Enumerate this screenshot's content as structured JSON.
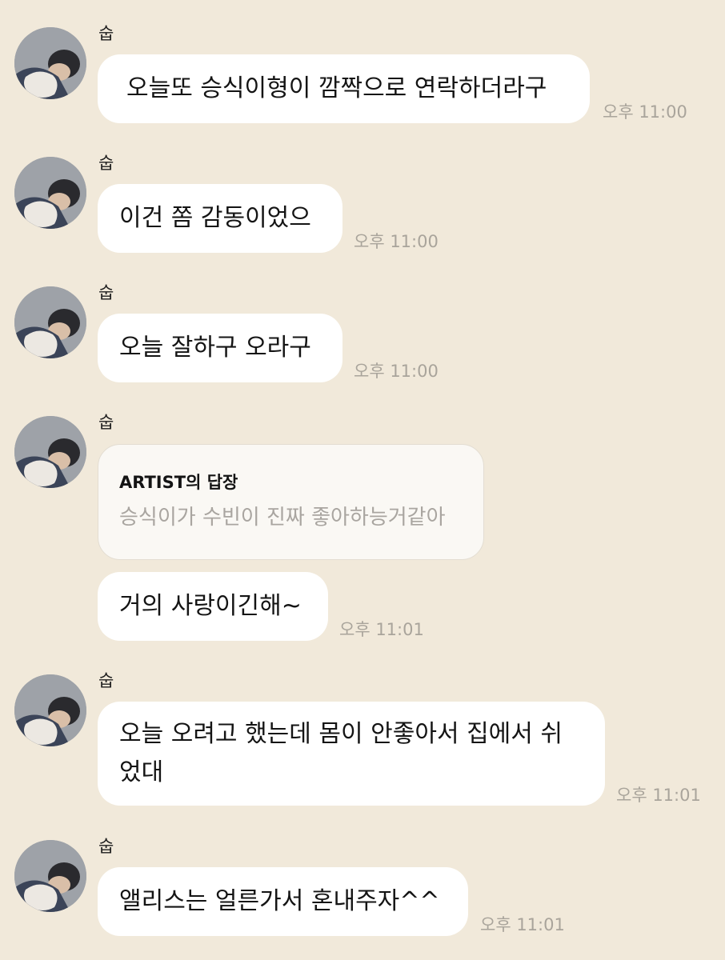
{
  "sender_name": "숩",
  "messages": [
    {
      "text": "오늘또 승식이형이 깜짝으로 연락하더라구",
      "time": "오후 11:00"
    },
    {
      "text": "이건 쫌 감동이었으",
      "time": "오후 11:00"
    },
    {
      "text": "오늘 잘하구 오라구",
      "time": "오후 11:00"
    },
    {
      "reply_header": "ARTIST의 답장",
      "reply_text": "승식이가 수빈이 진짜 좋아하능거같아",
      "text": "거의 사랑이긴해~",
      "time": "오후 11:01"
    },
    {
      "text": "오늘 오려고 했는데 몸이 안좋아서 집에서 쉬었대",
      "time": "오후 11:01"
    },
    {
      "text": "앨리스는 얼른가서 혼내주자^^",
      "time": "오후 11:01"
    }
  ]
}
